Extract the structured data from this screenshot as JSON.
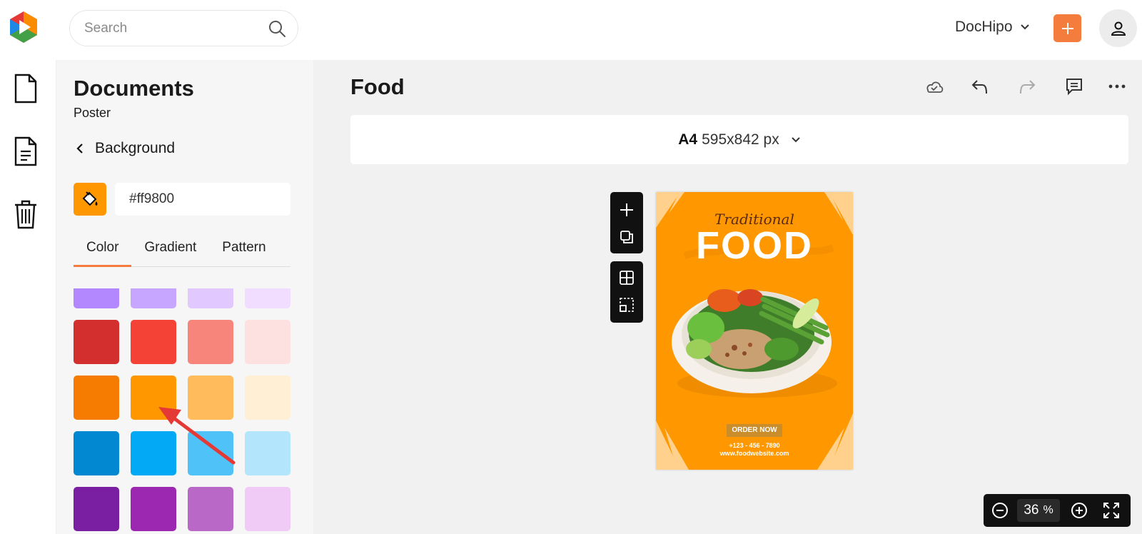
{
  "header": {
    "search_placeholder": "Search",
    "brand": "DocHipo",
    "accent": "#f47c3c"
  },
  "rail": {
    "items": [
      "document-icon",
      "document-text-icon",
      "trash-icon"
    ]
  },
  "panel": {
    "title": "Documents",
    "subtitle": "Poster",
    "section": "Background",
    "hex_value": "#ff9800",
    "tabs": [
      "Color",
      "Gradient",
      "Pattern"
    ],
    "active_tab": "Color",
    "swatch_rows": [
      [
        "#b388ff",
        "#c7a6ff",
        "#e1c8ff",
        "#f1ddff"
      ],
      [
        "#d32f2f",
        "#f44336",
        "#f8857b",
        "#fde0e0"
      ],
      [
        "#f57c00",
        "#ff9800",
        "#ffbb5c",
        "#ffefd4"
      ],
      [
        "#0288d1",
        "#03a9f4",
        "#4fc3f7",
        "#b3e5fc"
      ],
      [
        "#7b1fa2",
        "#9c27b0",
        "#ba68c8",
        "#efcbf5"
      ]
    ]
  },
  "editor": {
    "doc_title": "Food",
    "size_name": "A4",
    "size_dims": "595x842 px",
    "zoom_value": "36",
    "zoom_unit": "%"
  },
  "poster": {
    "script_title": "Traditional",
    "headline": "FOOD",
    "cta": "ORDER NOW",
    "phone": "+123 - 456 - 7890",
    "website": "www.foodwebsite.com",
    "background": "#ff9800"
  }
}
